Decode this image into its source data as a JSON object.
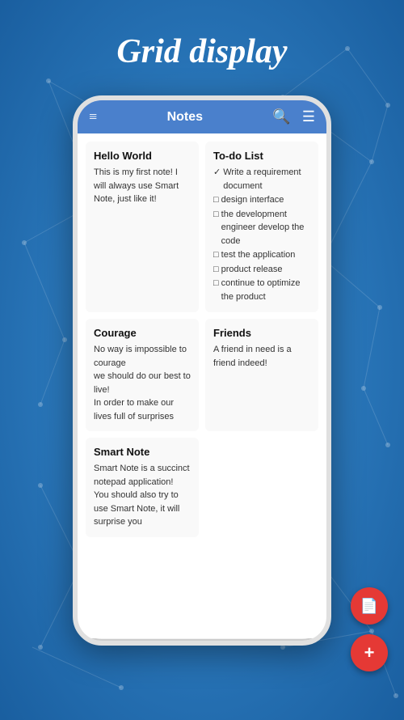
{
  "page": {
    "title": "Grid display",
    "background_color": "#2272C3"
  },
  "app_bar": {
    "title": "Notes",
    "hamburger_icon": "≡",
    "search_icon": "🔍",
    "filter_icon": "⚙"
  },
  "notes": [
    {
      "id": "hello-world",
      "title": "Hello World",
      "body": "This is my first note! I will always use Smart Note, just like it!",
      "type": "plain"
    },
    {
      "id": "todo-list",
      "title": "To-do List",
      "type": "checklist",
      "items": [
        {
          "checked": true,
          "text": "Write a requirement document"
        },
        {
          "checked": false,
          "text": "design interface"
        },
        {
          "checked": false,
          "text": "the development engineer develop the code"
        },
        {
          "checked": false,
          "text": "test the application"
        },
        {
          "checked": false,
          "text": "product release"
        },
        {
          "checked": false,
          "text": "continue to optimize the product"
        }
      ]
    },
    {
      "id": "courage",
      "title": "Courage",
      "body": "No way is impossible to courage\nwe should do our best to live!\nIn order to make our lives full of surprises",
      "type": "plain"
    },
    {
      "id": "friends",
      "title": "Friends",
      "body": "A friend in need is a friend indeed!",
      "type": "plain"
    },
    {
      "id": "smart-note",
      "title": "Smart Note",
      "body": "Smart Note is a succinct notepad application!\nYou should also try to use Smart Note, it will surprise you",
      "type": "plain"
    }
  ],
  "fab": {
    "doc_icon": "📄",
    "add_icon": "+"
  }
}
